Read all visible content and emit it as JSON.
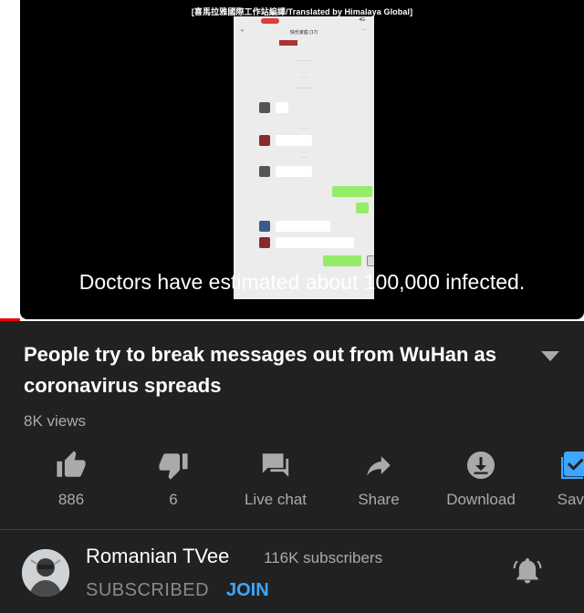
{
  "video": {
    "top_caption": "[喜馬拉雅國際工作站編譯/Translated by Himalaya Global]",
    "subtitle": "Doctors have estimated about 100,000 infected.",
    "phone": {
      "signal": "4G",
      "back": "<",
      "chat_title": "快乐家庭 (17)",
      "more": "···"
    }
  },
  "title": "People try to break messages out from WuHan as coronavirus spreads",
  "views": "8K views",
  "actions": {
    "like": "886",
    "dislike": "6",
    "live_chat": "Live chat",
    "share": "Share",
    "download": "Download",
    "save": "Save"
  },
  "channel": {
    "name": "Romanian TVee",
    "subscribers": "116K subscribers",
    "subscribed": "SUBSCRIBED",
    "join": "JOIN"
  },
  "colors": {
    "background": "#212121",
    "accent_blue": "#3ea6ff",
    "progress_red": "#ee0000"
  }
}
